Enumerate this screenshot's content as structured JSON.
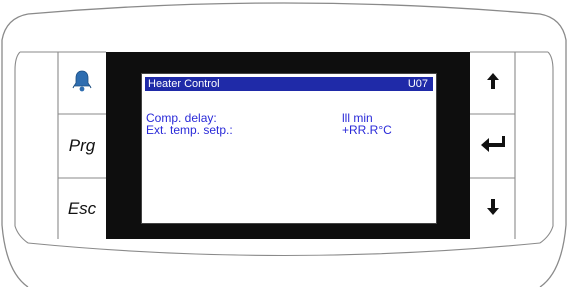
{
  "left_keys": {
    "alarm_icon": "bell-icon",
    "prg_label": "Prg",
    "esc_label": "Esc"
  },
  "right_keys": {
    "up_icon": "arrow-up-icon",
    "enter_icon": "enter-icon",
    "down_icon": "arrow-down-icon"
  },
  "display": {
    "title": "Heater Control",
    "screen_code": "U07",
    "rows": [
      {
        "label": "Comp. delay:",
        "value": "lll min"
      },
      {
        "label": "Ext. temp. setp.:",
        "value": "+RR.R°C"
      }
    ]
  },
  "colors": {
    "title_bar": "#1f2aa8",
    "text": "#2a2ad8",
    "bezel": "#0e0e0e",
    "alarm_icon": "#2e6db0"
  }
}
